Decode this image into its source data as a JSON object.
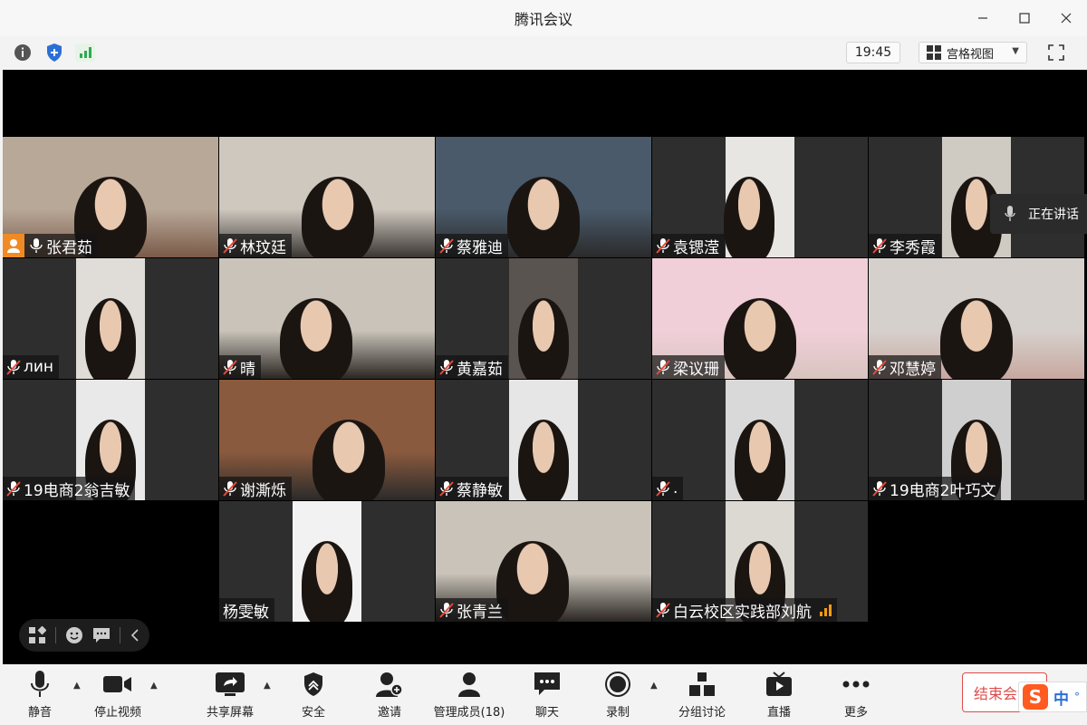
{
  "window": {
    "title": "腾讯会议"
  },
  "infobar": {
    "time": "19:45",
    "view_mode": "宫格视图"
  },
  "speaking": {
    "label": "正在讲话"
  },
  "participants": [
    {
      "name": "张君茹",
      "mic": "on",
      "host": true
    },
    {
      "name": "林玟廷",
      "mic": "muted"
    },
    {
      "name": "蔡雅迪",
      "mic": "muted"
    },
    {
      "name": "袁锶滢",
      "mic": "muted"
    },
    {
      "name": "李秀霞",
      "mic": "muted"
    },
    {
      "name": "лин",
      "mic": "muted"
    },
    {
      "name": "晴",
      "mic": "muted"
    },
    {
      "name": "黄嘉茹",
      "mic": "muted"
    },
    {
      "name": "梁议珊",
      "mic": "muted"
    },
    {
      "name": "邓慧婷",
      "mic": "muted"
    },
    {
      "name": "19电商2翁吉敏",
      "mic": "muted"
    },
    {
      "name": "谢澌烁",
      "mic": "muted"
    },
    {
      "name": "蔡静敏",
      "mic": "muted"
    },
    {
      "name": ".",
      "mic": "muted"
    },
    {
      "name": "19电商2叶巧文",
      "mic": "muted"
    },
    {
      "name": "杨雯敏",
      "mic": "none"
    },
    {
      "name": "张青兰",
      "mic": "muted"
    },
    {
      "name": "白云校区实践部刘航",
      "mic": "muted",
      "signal": true
    }
  ],
  "toolbar": {
    "mute": "静音",
    "stop_video": "停止视频",
    "share_screen": "共享屏幕",
    "security": "安全",
    "invite": "邀请",
    "manage_members": "管理成员(18)",
    "chat": "聊天",
    "record": "录制",
    "breakout": "分组讨论",
    "live": "直播",
    "more": "更多",
    "end_meeting": "结束会议"
  },
  "ime": {
    "mode": "中"
  },
  "colors": {
    "host_badge": "#f08a24",
    "active_border": "#2ecc71",
    "end_button": "#e04b4b",
    "signal": "#f39c12"
  }
}
